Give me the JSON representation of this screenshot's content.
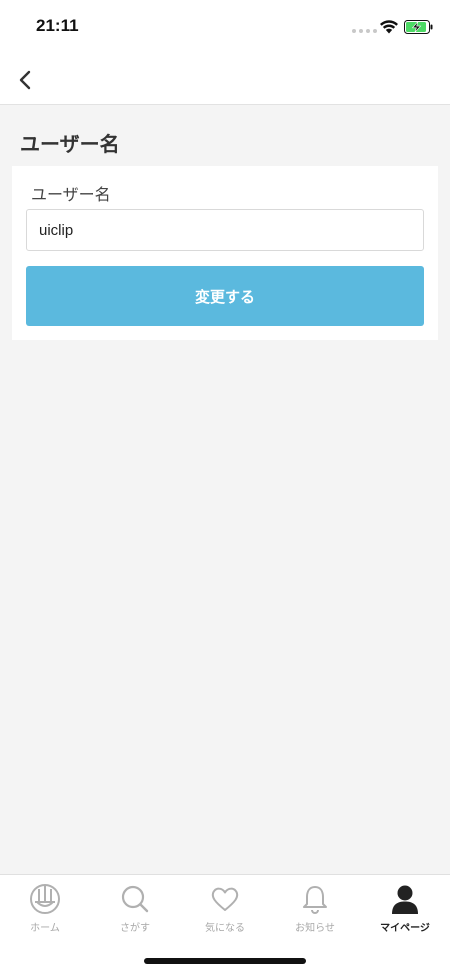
{
  "status_bar": {
    "time": "21:11",
    "icons": [
      "signal-dots-icon",
      "wifi-icon",
      "battery-charging-icon"
    ],
    "battery_color": "#4cd964"
  },
  "nav": {
    "back_icon": "chevron-left-icon"
  },
  "page": {
    "title": "ユーザー名"
  },
  "form": {
    "field_label": "ユーザー名",
    "username_value": "uiclip",
    "submit_label": "変更する",
    "accent_color": "#5bb9de"
  },
  "tab_bar": {
    "items": [
      {
        "label": "ホーム",
        "icon": "home-logo-icon",
        "active": false
      },
      {
        "label": "さがす",
        "icon": "search-icon",
        "active": false
      },
      {
        "label": "気になる",
        "icon": "heart-icon",
        "active": false
      },
      {
        "label": "お知らせ",
        "icon": "bell-icon",
        "active": false
      },
      {
        "label": "マイページ",
        "icon": "person-icon",
        "active": true
      }
    ]
  }
}
